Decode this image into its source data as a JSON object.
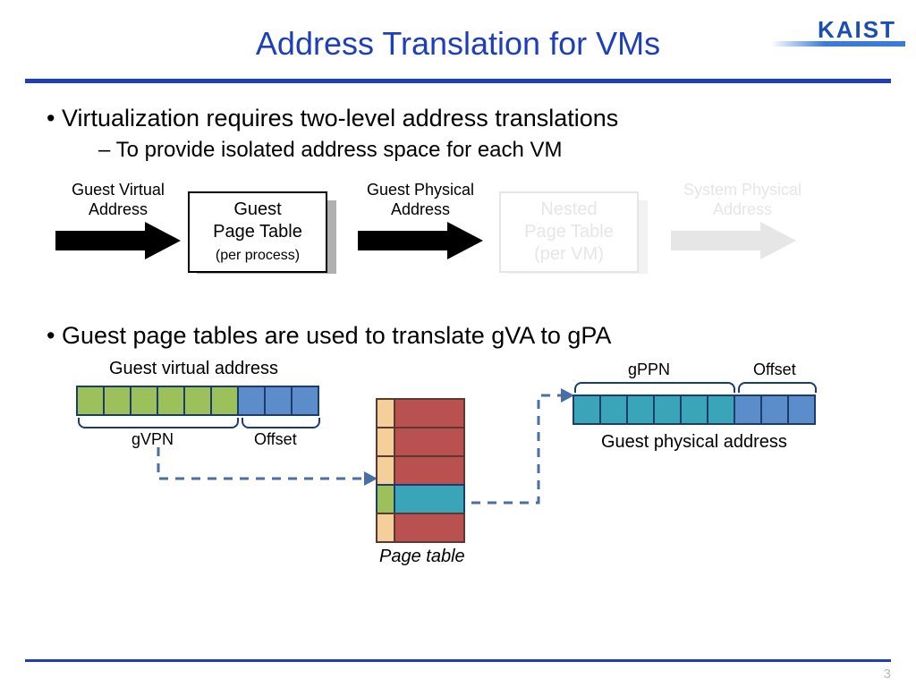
{
  "title": "Address Translation for VMs",
  "logo": "KAIST",
  "bullets": {
    "b1": "Virtualization requires two-level address translations",
    "b1a": "To provide isolated address space for each VM",
    "b2": "Guest page tables are used to translate gVA to gPA"
  },
  "pipeline": {
    "label_gva_l1": "Guest Virtual",
    "label_gva_l2": "Address",
    "box1_l1": "Guest",
    "box1_l2": "Page Table",
    "box1_l3": "(per process)",
    "label_gpa_l1": "Guest Physical",
    "label_gpa_l2": "Address",
    "box2_l1": "Nested",
    "box2_l2": "Page Table",
    "box2_l3": "(per VM)",
    "label_spa_l1": "System Physical",
    "label_spa_l2": "Address"
  },
  "diagram": {
    "gva_title": "Guest virtual address",
    "gvpn": "gVPN",
    "offset": "Offset",
    "gpa_title": "Guest physical address",
    "gppn": "gPPN",
    "ptable": "Page table"
  },
  "page_number": "3"
}
